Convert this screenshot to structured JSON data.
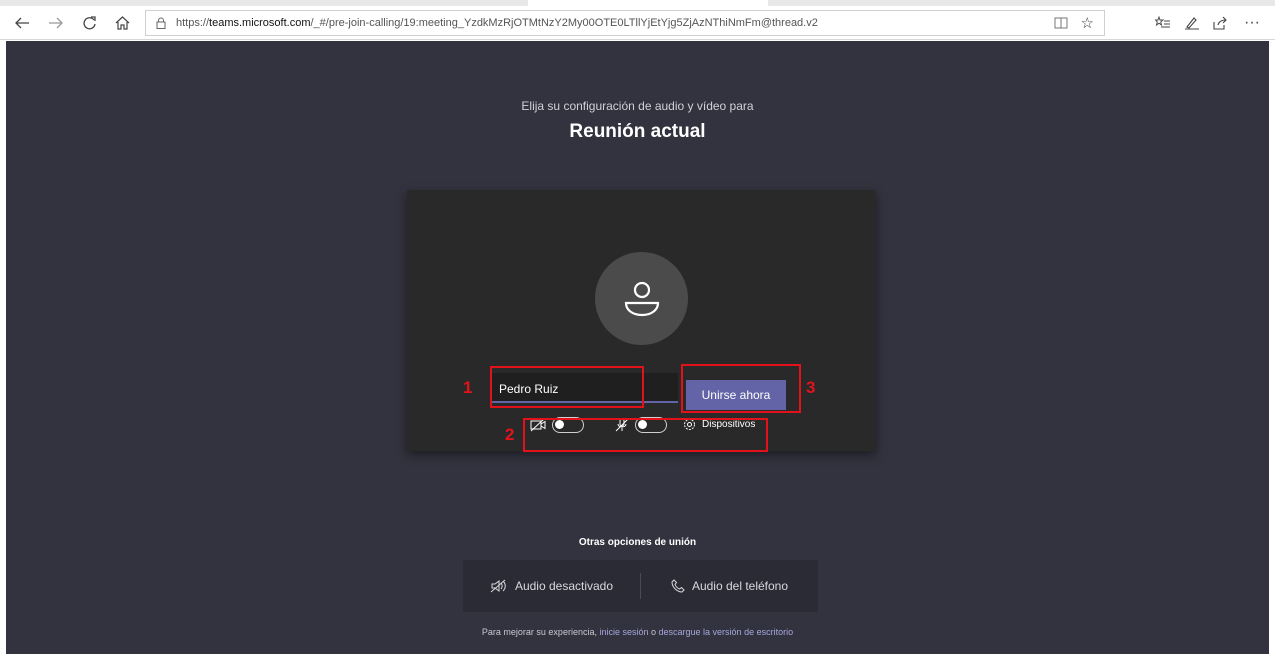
{
  "browser": {
    "url_prefix": "https://",
    "url_domain": "teams.microsoft.com",
    "url_path": "/_#/pre-join-calling/19:meeting_YzdkMzRjOTMtNzY2My00OTE0LTllYjEtYjg5ZjAzNThiNmFm@thread.v2",
    "icons": [
      "back-icon",
      "forward-icon",
      "refresh-icon",
      "home-icon",
      "lock-icon",
      "reading-view-icon",
      "favorite-star-icon",
      "favorites-list-icon",
      "pen-icon",
      "share-icon",
      "more-icon"
    ]
  },
  "prejoin": {
    "subtitle": "Elija su configuración de audio y vídeo para",
    "title": "Reunión actual",
    "name_value": "Pedro Ruiz",
    "join_label": "Unirse ahora",
    "devices_label": "Dispositivos",
    "video_on": false,
    "mic_on": false
  },
  "annotations": {
    "n1": "1",
    "n2": "2",
    "n3": "3",
    "color": "#e3121a"
  },
  "other": {
    "title": "Otras opciones de unión",
    "audio_off": "Audio desactivado",
    "phone_audio": "Audio del teléfono"
  },
  "footer": {
    "text1": "Para mejorar su experiencia, ",
    "link1": "inicie sesión",
    "text2": " o ",
    "link2": "descargue la versión de escritorio"
  },
  "colors": {
    "background": "#33333f",
    "panel": "#292929",
    "accent": "#6264a7"
  }
}
